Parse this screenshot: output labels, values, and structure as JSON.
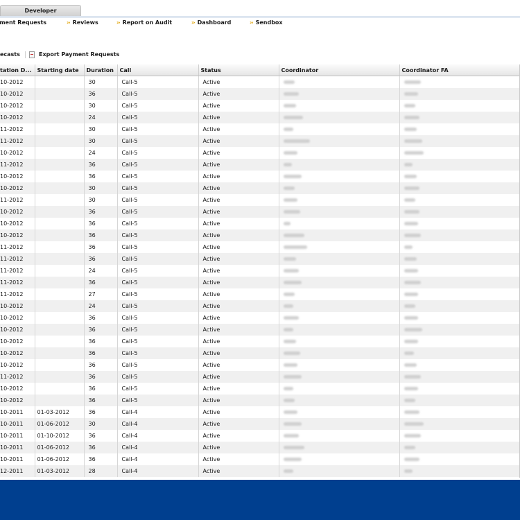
{
  "top": {
    "tab_label": "Developer"
  },
  "nav": [
    "yment Requests",
    "Reviews",
    "Report on Audit",
    "Dashboard",
    "Sendbox"
  ],
  "toolbar": {
    "left_label": "recasts",
    "export_label": "Export Payment Requests"
  },
  "grid": {
    "columns": [
      "tation D...",
      "Starting date",
      "Duration",
      "Call",
      "Status",
      "Coordinator",
      "Coordinator FA"
    ],
    "rows": [
      [
        "10-2012",
        "",
        "30",
        "Call-5",
        "Active"
      ],
      [
        "10-2012",
        "",
        "36",
        "Call-5",
        "Active"
      ],
      [
        "10-2012",
        "",
        "30",
        "Call-5",
        "Active"
      ],
      [
        "10-2012",
        "",
        "24",
        "Call-5",
        "Active"
      ],
      [
        "11-2012",
        "",
        "30",
        "Call-5",
        "Active"
      ],
      [
        "11-2012",
        "",
        "30",
        "Call-5",
        "Active"
      ],
      [
        "10-2012",
        "",
        "24",
        "Call-5",
        "Active"
      ],
      [
        "11-2012",
        "",
        "36",
        "Call-5",
        "Active"
      ],
      [
        "10-2012",
        "",
        "36",
        "Call-5",
        "Active"
      ],
      [
        "10-2012",
        "",
        "30",
        "Call-5",
        "Active"
      ],
      [
        "11-2012",
        "",
        "30",
        "Call-5",
        "Active"
      ],
      [
        "10-2012",
        "",
        "36",
        "Call-5",
        "Active"
      ],
      [
        "10-2012",
        "",
        "36",
        "Call-5",
        "Active"
      ],
      [
        "10-2012",
        "",
        "36",
        "Call-5",
        "Active"
      ],
      [
        "11-2012",
        "",
        "36",
        "Call-5",
        "Active"
      ],
      [
        "11-2012",
        "",
        "36",
        "Call-5",
        "Active"
      ],
      [
        "11-2012",
        "",
        "24",
        "Call-5",
        "Active"
      ],
      [
        "11-2012",
        "",
        "36",
        "Call-5",
        "Active"
      ],
      [
        "11-2012",
        "",
        "27",
        "Call-5",
        "Active"
      ],
      [
        "10-2012",
        "",
        "24",
        "Call-5",
        "Active"
      ],
      [
        "10-2012",
        "",
        "36",
        "Call-5",
        "Active"
      ],
      [
        "10-2012",
        "",
        "36",
        "Call-5",
        "Active"
      ],
      [
        "10-2012",
        "",
        "36",
        "Call-5",
        "Active"
      ],
      [
        "10-2012",
        "",
        "36",
        "Call-5",
        "Active"
      ],
      [
        "10-2012",
        "",
        "36",
        "Call-5",
        "Active"
      ],
      [
        "11-2012",
        "",
        "36",
        "Call-5",
        "Active"
      ],
      [
        "10-2012",
        "",
        "36",
        "Call-5",
        "Active"
      ],
      [
        "10-2012",
        "",
        "36",
        "Call-5",
        "Active"
      ],
      [
        "10-2011",
        "01-03-2012",
        "36",
        "Call-4",
        "Active"
      ],
      [
        "10-2011",
        "01-06-2012",
        "30",
        "Call-4",
        "Active"
      ],
      [
        "10-2011",
        "01-10-2012",
        "36",
        "Call-4",
        "Active"
      ],
      [
        "10-2011",
        "01-06-2012",
        "36",
        "Call-4",
        "Active"
      ],
      [
        "10-2011",
        "01-06-2012",
        "36",
        "Call-4",
        "Active"
      ],
      [
        "12-2011",
        "01-03-2012",
        "28",
        "Call-4",
        "Active"
      ]
    ]
  },
  "colors": {
    "footer": "#003f8f",
    "accent_chevron": "#e0a200"
  }
}
